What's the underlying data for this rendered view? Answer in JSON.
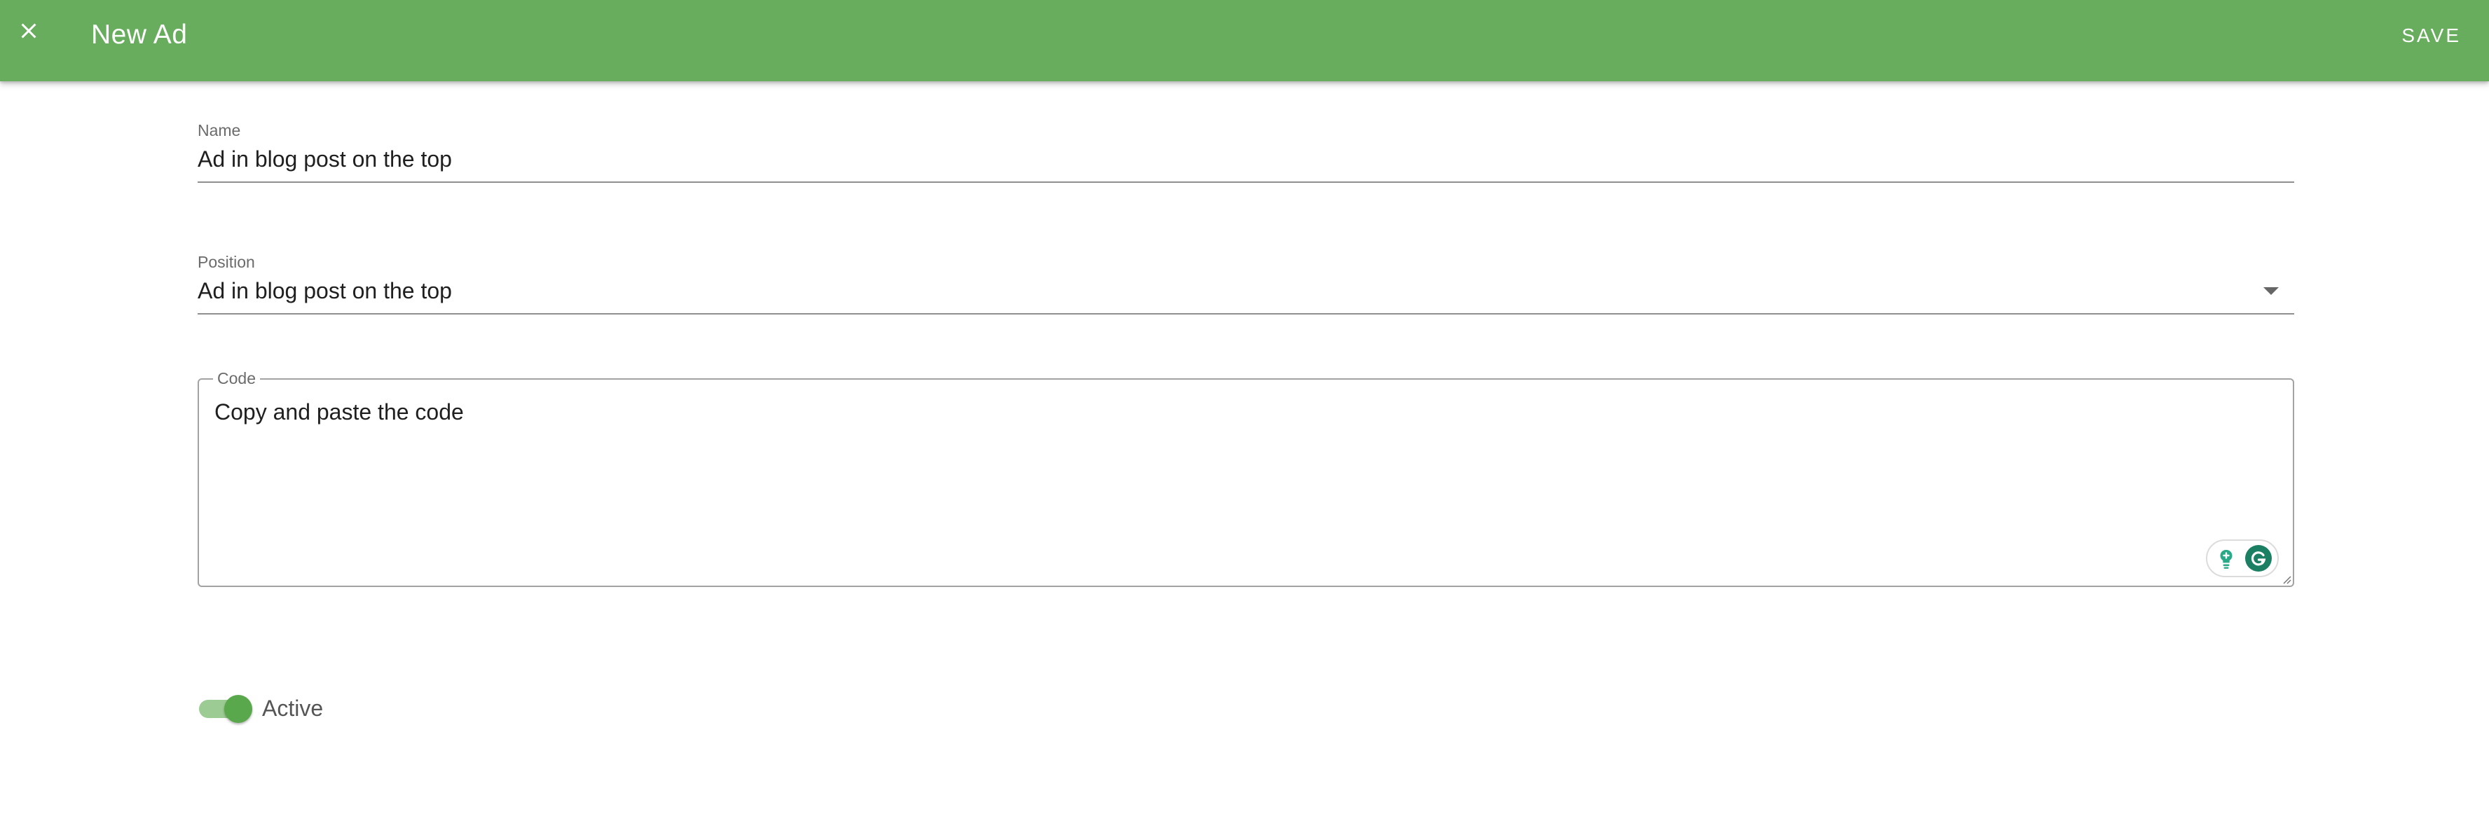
{
  "header": {
    "title": "New Ad",
    "save_label": "SAVE",
    "close_icon": "close-icon",
    "background_color": "#68ad5d"
  },
  "form": {
    "name": {
      "label": "Name",
      "value": "Ad in blog post on the top"
    },
    "position": {
      "label": "Position",
      "value": "Ad in blog post on the top",
      "icon": "dropdown-arrow-icon"
    },
    "code": {
      "label": "Code",
      "value": "Copy and paste the code",
      "extension_icons": [
        "lightbulb-icon",
        "grammarly-icon"
      ]
    },
    "active": {
      "label": "Active",
      "checked": true,
      "accent_color": "#5aa84c"
    }
  }
}
